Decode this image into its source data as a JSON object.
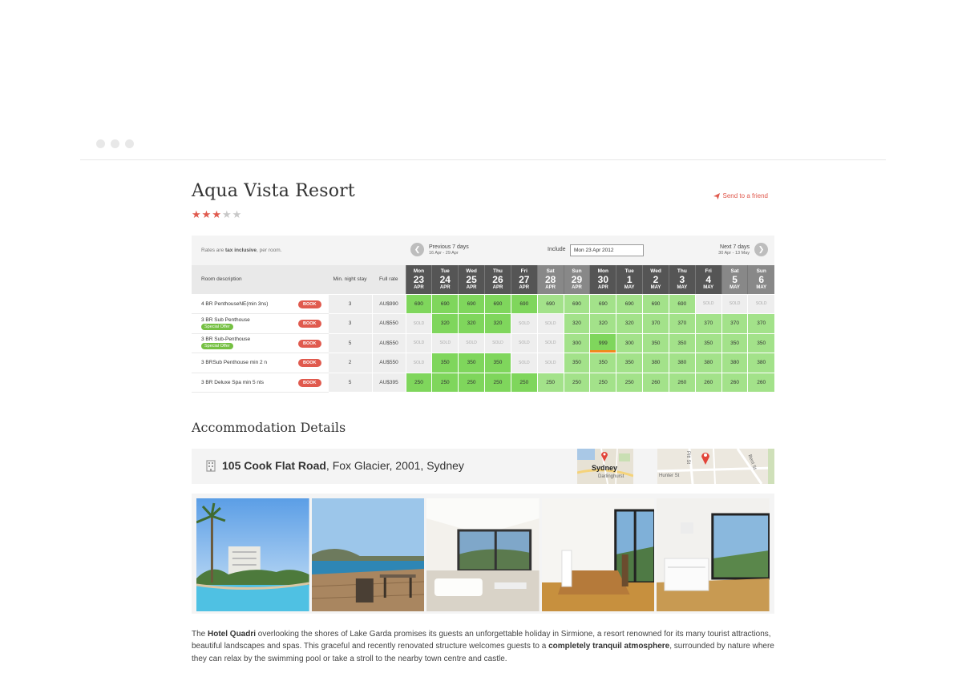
{
  "hotel": {
    "name": "Aqua Vista Resort",
    "rating": 3,
    "max_rating": 5,
    "send_label": "Send to a friend"
  },
  "colors": {
    "accent": "#e05a4e",
    "available_dark": "#7fd65c",
    "available_light": "#a3e28a",
    "special_offer": "#76c043",
    "star_on": "#e05a4e",
    "star_off": "#c8c8c8"
  },
  "rates": {
    "tax_note_prefix": "Rates are ",
    "tax_note_bold": "tax inclusive",
    "tax_note_suffix": ", per room.",
    "prev_label": "Previous 7 days",
    "prev_range": "16 Apr - 29 Apr",
    "next_label": "Next 7 days",
    "next_range": "30 Apr - 13 May",
    "include_label": "Include",
    "include_value": "Mon 23 Apr 2012",
    "col_room": "Room description",
    "col_min": "Min. night stay",
    "col_full": "Full rate",
    "book_label": "BOOK",
    "sold_label": "SOLD",
    "days": [
      {
        "dow": "Mon",
        "num": "23",
        "mon": "APR",
        "weekend": false
      },
      {
        "dow": "Tue",
        "num": "24",
        "mon": "APR",
        "weekend": false
      },
      {
        "dow": "Wed",
        "num": "25",
        "mon": "APR",
        "weekend": false
      },
      {
        "dow": "Thu",
        "num": "26",
        "mon": "APR",
        "weekend": false
      },
      {
        "dow": "Fri",
        "num": "27",
        "mon": "APR",
        "weekend": false
      },
      {
        "dow": "Sat",
        "num": "28",
        "mon": "APR",
        "weekend": true
      },
      {
        "dow": "Sun",
        "num": "29",
        "mon": "APR",
        "weekend": true
      },
      {
        "dow": "Mon",
        "num": "30",
        "mon": "APR",
        "weekend": false
      },
      {
        "dow": "Tue",
        "num": "1",
        "mon": "MAY",
        "weekend": false
      },
      {
        "dow": "Wed",
        "num": "2",
        "mon": "MAY",
        "weekend": false
      },
      {
        "dow": "Thu",
        "num": "3",
        "mon": "MAY",
        "weekend": false
      },
      {
        "dow": "Fri",
        "num": "4",
        "mon": "MAY",
        "weekend": false
      },
      {
        "dow": "Sat",
        "num": "5",
        "mon": "MAY",
        "weekend": true
      },
      {
        "dow": "Sun",
        "num": "6",
        "mon": "MAY",
        "weekend": true
      }
    ],
    "rooms": [
      {
        "name": "4 BR PenthouseNE(min 3ns)",
        "special": "",
        "min": "3",
        "full": "AU$990",
        "cells": [
          [
            "690",
            "d"
          ],
          [
            "690",
            "d"
          ],
          [
            "690",
            "d"
          ],
          [
            "690",
            "d"
          ],
          [
            "690",
            "d"
          ],
          [
            "690",
            "l"
          ],
          [
            "690",
            "l"
          ],
          [
            "690",
            "l"
          ],
          [
            "690",
            "l"
          ],
          [
            "690",
            "l"
          ],
          [
            "690",
            "l"
          ],
          [
            "SOLD",
            "s"
          ],
          [
            "SOLD",
            "s"
          ],
          [
            "SOLD",
            "s"
          ]
        ]
      },
      {
        "name": "3 BR Sub Penthouse",
        "special": "Special Offer",
        "min": "3",
        "full": "AU$550",
        "cells": [
          [
            "SOLD",
            "s"
          ],
          [
            "320",
            "d"
          ],
          [
            "320",
            "d"
          ],
          [
            "320",
            "d"
          ],
          [
            "SOLD",
            "s"
          ],
          [
            "SOLD",
            "s"
          ],
          [
            "320",
            "l"
          ],
          [
            "320",
            "l"
          ],
          [
            "320",
            "l"
          ],
          [
            "370",
            "l"
          ],
          [
            "370",
            "l"
          ],
          [
            "370",
            "l"
          ],
          [
            "370",
            "l"
          ],
          [
            "370",
            "l"
          ]
        ]
      },
      {
        "name": "3 BR Sub-Penthouse",
        "special": "Special Offer",
        "min": "5",
        "full": "AU$550",
        "cells": [
          [
            "SOLD",
            "s"
          ],
          [
            "SOLD",
            "s"
          ],
          [
            "SOLD",
            "s"
          ],
          [
            "SOLD",
            "s"
          ],
          [
            "SOLD",
            "s"
          ],
          [
            "SOLD",
            "s"
          ],
          [
            "300",
            "l"
          ],
          [
            "999",
            "d*"
          ],
          [
            "300",
            "l"
          ],
          [
            "350",
            "l"
          ],
          [
            "350",
            "l"
          ],
          [
            "350",
            "l"
          ],
          [
            "350",
            "l"
          ],
          [
            "350",
            "l"
          ]
        ]
      },
      {
        "name": "3 BRSub Penthouse min 2 n",
        "special": "",
        "min": "2",
        "full": "AU$550",
        "cells": [
          [
            "SOLD",
            "s"
          ],
          [
            "350",
            "d"
          ],
          [
            "350",
            "d"
          ],
          [
            "350",
            "d"
          ],
          [
            "SOLD",
            "s"
          ],
          [
            "SOLD",
            "s"
          ],
          [
            "350",
            "l"
          ],
          [
            "350",
            "l"
          ],
          [
            "350",
            "l"
          ],
          [
            "380",
            "l"
          ],
          [
            "380",
            "l"
          ],
          [
            "380",
            "l"
          ],
          [
            "380",
            "l"
          ],
          [
            "380",
            "l"
          ]
        ]
      },
      {
        "name": "3 BR Deluxe Spa min 5 nts",
        "special": "",
        "min": "5",
        "full": "AU$395",
        "cells": [
          [
            "250",
            "d"
          ],
          [
            "250",
            "d"
          ],
          [
            "250",
            "d"
          ],
          [
            "250",
            "d"
          ],
          [
            "250",
            "d"
          ],
          [
            "250",
            "l"
          ],
          [
            "250",
            "l"
          ],
          [
            "250",
            "l"
          ],
          [
            "250",
            "l"
          ],
          [
            "260",
            "l"
          ],
          [
            "260",
            "l"
          ],
          [
            "260",
            "l"
          ],
          [
            "260",
            "l"
          ],
          [
            "260",
            "l"
          ]
        ]
      }
    ]
  },
  "accommodation": {
    "heading": "Accommodation Details",
    "address_bold": "105 Cook Flat Road",
    "address_rest": ", Fox Glacier, 2001, Sydney",
    "map1_city": "Sydney",
    "map1_sub": "Darlinghurst",
    "map2_street1": "Hunter St",
    "map2_street2": "Pitt St",
    "map2_street3": "Bent St",
    "photos": [
      "pool-photo",
      "deck-ocean-photo",
      "living-room-photo",
      "dining-room-photo",
      "kitchen-photo"
    ]
  },
  "description": {
    "p1": "The ",
    "b1": "Hotel Quadri",
    "p2": " overlooking the shores of Lake Garda promises its guests an unforgettable holiday in Sirmione, a resort renowned for its many tourist attractions, beautiful landscapes and spas. This graceful and recently renovated structure welcomes guests to a ",
    "b2": "completely tranquil atmosphere",
    "p3": ", surrounded by nature where they can relax by the swimming pool or take a stroll to the nearby town centre and castle."
  }
}
